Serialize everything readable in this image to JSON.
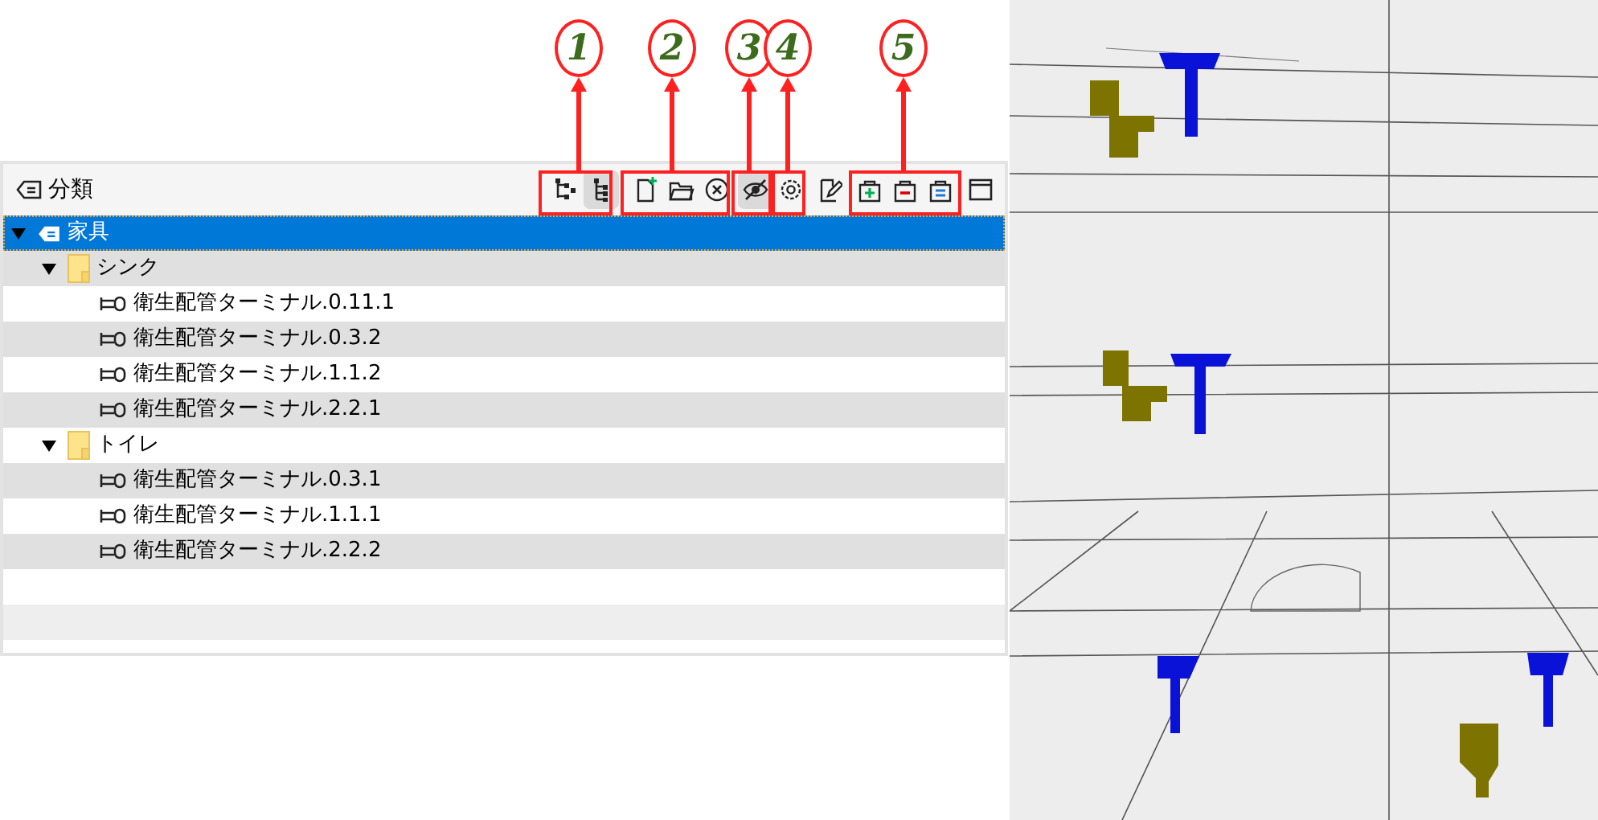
{
  "panel": {
    "title": "分類",
    "toolbar": [
      {
        "pressed": false
      },
      {
        "pressed": true
      },
      {
        "pressed": false
      },
      {
        "pressed": false
      },
      {
        "pressed": false
      },
      {
        "pressed": true
      },
      {
        "pressed": false
      },
      {
        "pressed": false
      },
      {
        "pressed": false
      },
      {
        "pressed": false
      },
      {
        "pressed": false
      },
      {
        "pressed": false
      }
    ],
    "tree": [
      {
        "kind": "category",
        "label": "家具",
        "selected": true,
        "expanded": true,
        "children": [
          {
            "kind": "folder",
            "label": "シンク",
            "selected": false,
            "expanded": true,
            "children": [
              {
                "kind": "terminal",
                "label": "衛生配管ターミナル.0.11.1",
                "selected": false
              },
              {
                "kind": "terminal",
                "label": "衛生配管ターミナル.0.3.2",
                "selected": false
              },
              {
                "kind": "terminal",
                "label": "衛生配管ターミナル.1.1.2",
                "selected": false
              },
              {
                "kind": "terminal",
                "label": "衛生配管ターミナル.2.2.1",
                "selected": false
              }
            ]
          },
          {
            "kind": "folder",
            "label": "トイレ",
            "selected": false,
            "expanded": true,
            "children": [
              {
                "kind": "terminal",
                "label": "衛生配管ターミナル.0.3.1",
                "selected": false
              },
              {
                "kind": "terminal",
                "label": "衛生配管ターミナル.1.1.1",
                "selected": false
              },
              {
                "kind": "terminal",
                "label": "衛生配管ターミナル.2.2.2",
                "selected": false
              }
            ]
          }
        ]
      }
    ]
  },
  "callouts": [
    {
      "number": "1"
    },
    {
      "number": "2"
    },
    {
      "number": "3"
    },
    {
      "number": "4"
    },
    {
      "number": "5"
    }
  ]
}
